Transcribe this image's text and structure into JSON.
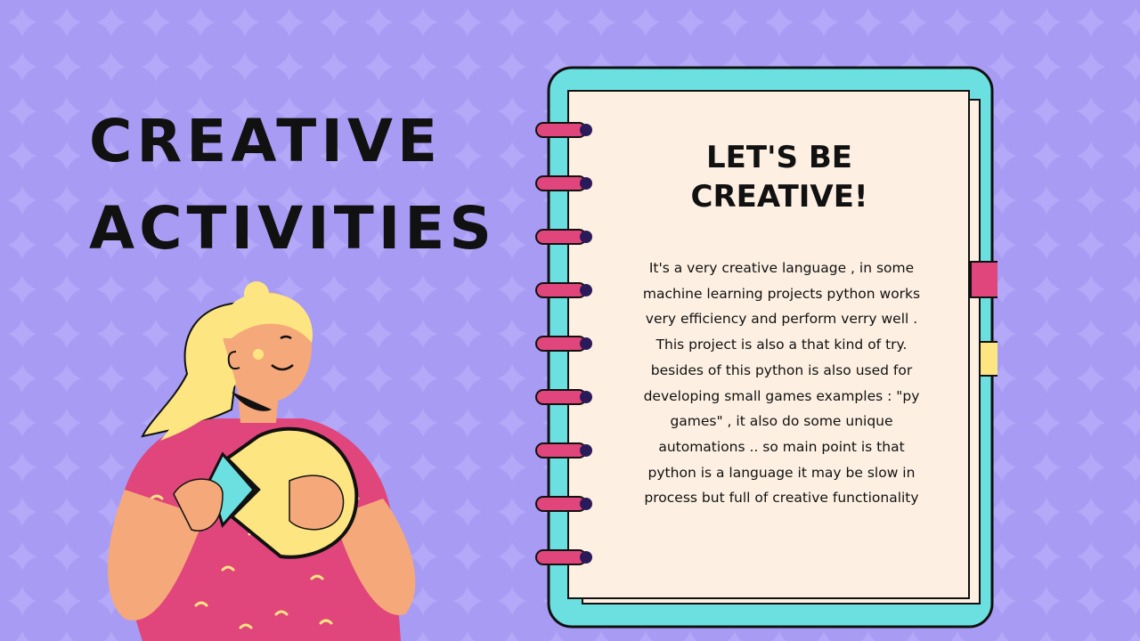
{
  "slide": {
    "title_line1": "CREATIVE",
    "title_line2": "ACTIVITIES"
  },
  "notebook": {
    "heading_line1": "LET'S BE",
    "heading_line2": "CREATIVE!",
    "body": "It's a very creative language , in some machine learning projects python works very efficiency and perform verry well . This project is also a that kind of try. besides of this python is also used for developing small games examples : \"py games\" , it also do some unique automations .. so main point is that python is a language it may be slow in process but full of creative functionality"
  },
  "colors": {
    "background": "#b3a9f8",
    "notebook_frame": "#6ce0e0",
    "paper": "#fdf0e2",
    "ring": "#e0457b",
    "bookmark_pink": "#e0457b",
    "bookmark_yellow": "#fde582",
    "shirt": "#e0457b",
    "hair": "#fde582",
    "skin": "#f5a97a"
  },
  "icons": [
    "woman-holding-puzzle-illustration",
    "spiral-ring-icon",
    "bookmark-ribbon-icon"
  ]
}
